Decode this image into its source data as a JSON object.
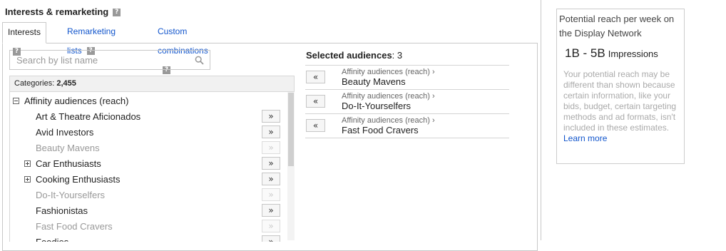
{
  "panel": {
    "title": "Interests & remarketing",
    "help_glyph": "?"
  },
  "tabs": [
    {
      "label": "Interests",
      "active": true
    },
    {
      "label": "Remarketing lists",
      "active": false
    },
    {
      "label": "Custom combinations",
      "active": false
    }
  ],
  "search": {
    "placeholder": "Search by list name",
    "value": ""
  },
  "categories": {
    "label": "Categories:",
    "count": "2,455"
  },
  "tree": {
    "root": "Affinity audiences (reach)",
    "add_glyph": "»",
    "items": [
      {
        "label": "Art & Theatre Aficionados",
        "expandable": false,
        "added": false
      },
      {
        "label": "Avid Investors",
        "expandable": false,
        "added": false
      },
      {
        "label": "Beauty Mavens",
        "expandable": false,
        "added": true
      },
      {
        "label": "Car Enthusiasts",
        "expandable": true,
        "added": false
      },
      {
        "label": "Cooking Enthusiasts",
        "expandable": true,
        "added": false
      },
      {
        "label": "Do-It-Yourselfers",
        "expandable": false,
        "added": true
      },
      {
        "label": "Fashionistas",
        "expandable": false,
        "added": false
      },
      {
        "label": "Fast Food Cravers",
        "expandable": false,
        "added": true
      },
      {
        "label": "Foodies",
        "expandable": false,
        "added": false
      }
    ]
  },
  "selected": {
    "label": "Selected audiences",
    "count": "3",
    "remove_glyph": "«",
    "items": [
      {
        "parent": "Affinity audiences (reach) ›",
        "name": "Beauty Mavens"
      },
      {
        "parent": "Affinity audiences (reach) ›",
        "name": "Do-It-Yourselfers"
      },
      {
        "parent": "Affinity audiences (reach) ›",
        "name": "Fast Food Cravers"
      }
    ]
  },
  "reach": {
    "title": "Potential reach per week on the Display Network",
    "value": "1B - 5B",
    "unit": "Impressions",
    "note": "Your potential reach may be different than shown because certain information, like your bids, budget, certain targeting methods and ad formats, isn't included in these estimates.",
    "link": "Learn more"
  }
}
